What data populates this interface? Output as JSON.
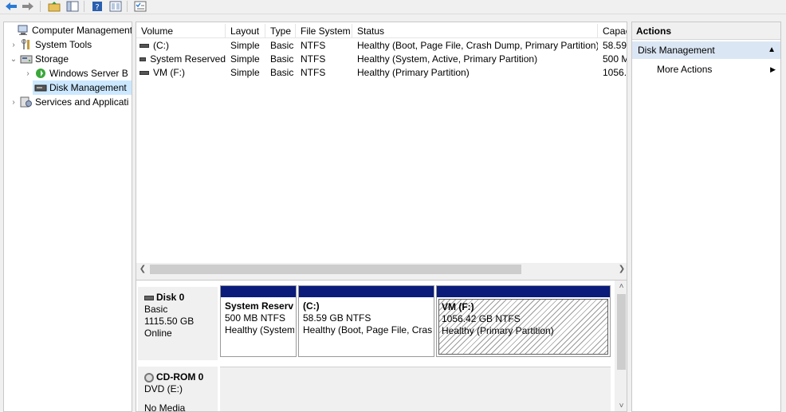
{
  "toolbar": {
    "buttons": [
      "back-icon",
      "forward-icon",
      "up-folder-icon",
      "show-hide-tree-icon",
      "help-icon",
      "properties-icon",
      "checklist-icon"
    ]
  },
  "tree": {
    "items": [
      {
        "label": "Computer Management (",
        "icon": "computer-management-icon",
        "expander": ""
      },
      {
        "label": "System Tools",
        "icon": "tools-icon",
        "expander": "›"
      },
      {
        "label": "Storage",
        "icon": "storage-icon",
        "expander": "⌄"
      },
      {
        "label": "Windows Server B",
        "icon": "backup-icon",
        "expander": "›"
      },
      {
        "label": "Disk Management",
        "icon": "disk-icon",
        "expander": ""
      },
      {
        "label": "Services and Applicati",
        "icon": "services-icon",
        "expander": "›"
      }
    ]
  },
  "volumes": {
    "columns": [
      "Volume",
      "Layout",
      "Type",
      "File System",
      "Status",
      "Capac"
    ],
    "rows": [
      [
        "(C:)",
        "Simple",
        "Basic",
        "NTFS",
        "Healthy (Boot, Page File, Crash Dump, Primary Partition)",
        "58.59"
      ],
      [
        "System Reserved",
        "Simple",
        "Basic",
        "NTFS",
        "Healthy (System, Active, Primary Partition)",
        "500 M"
      ],
      [
        "VM (F:)",
        "Simple",
        "Basic",
        "NTFS",
        "Healthy (Primary Partition)",
        "1056.4"
      ]
    ]
  },
  "disks": [
    {
      "name": "Disk 0",
      "type": "Basic",
      "size": "1115.50 GB",
      "state": "Online",
      "partitions": [
        {
          "name": "System Reserv",
          "size": "500 MB NTFS",
          "status": "Healthy (System"
        },
        {
          "name": "(C:)",
          "size": "58.59 GB NTFS",
          "status": "Healthy (Boot, Page File, Crasl"
        },
        {
          "name": "VM  (F:)",
          "size": "1056.42 GB NTFS",
          "status": "Healthy (Primary Partition)"
        }
      ]
    },
    {
      "name": "CD-ROM 0",
      "type": "DVD (E:)",
      "state": "No Media"
    }
  ],
  "actions": {
    "title": "Actions",
    "section": "Disk Management",
    "items": [
      "More Actions"
    ]
  },
  "colors": {
    "partition_bar": "#0a1b7a",
    "selection": "#cce8ff",
    "action_section": "#dbe6f4"
  }
}
